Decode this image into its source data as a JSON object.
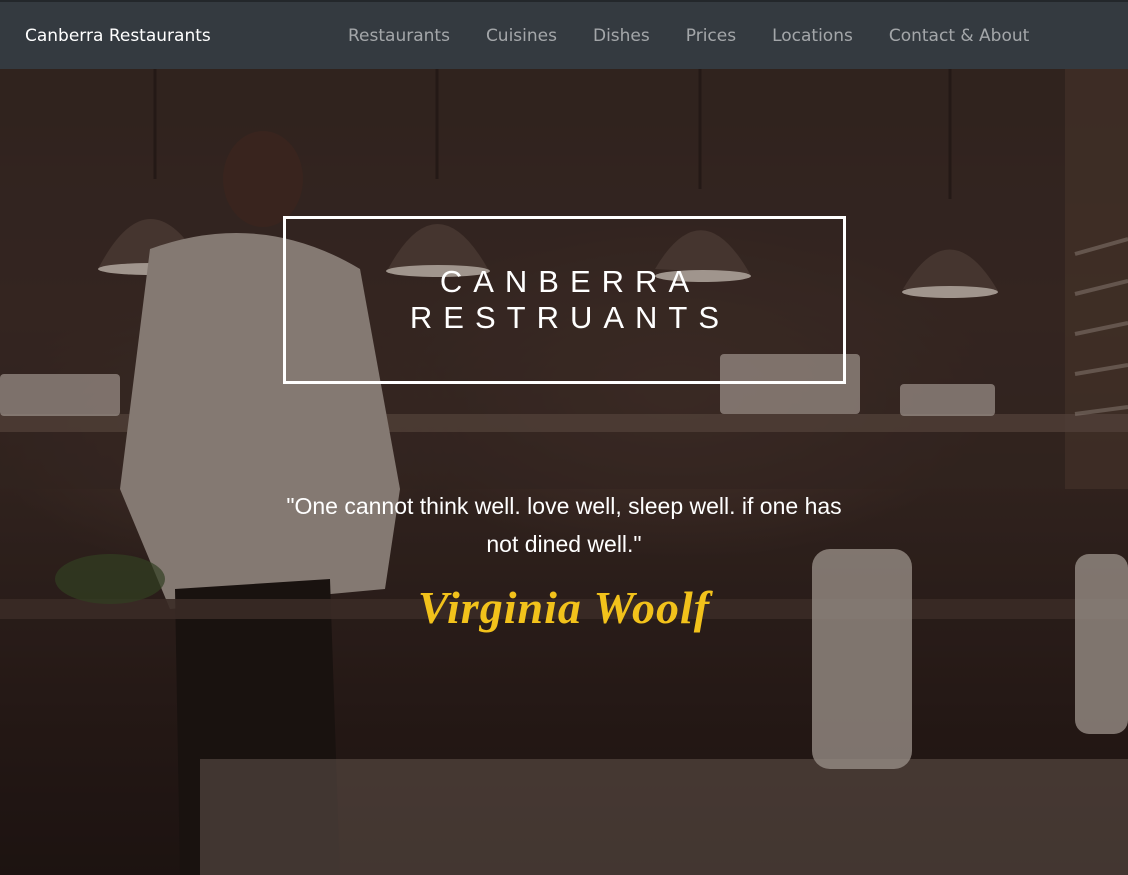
{
  "navbar": {
    "brand": "Canberra Restaurants",
    "links": [
      {
        "label": "Restaurants"
      },
      {
        "label": "Cuisines"
      },
      {
        "label": "Dishes"
      },
      {
        "label": "Prices"
      },
      {
        "label": "Locations"
      },
      {
        "label": "Contact & About"
      }
    ]
  },
  "hero": {
    "title_line1": "CANBERRA",
    "title_line2": "RESTRUANTS",
    "quote": "\"One cannot think well. love well, sleep well. if one has not dined well.\"",
    "author": "Virginia Woolf",
    "background_image": "restaurant-kitchen-photo"
  },
  "colors": {
    "navbar_bg": "#343a40",
    "nav_link": "#9a9ea3",
    "title_border": "#ffffff",
    "author_accent": "#f2c21b"
  }
}
